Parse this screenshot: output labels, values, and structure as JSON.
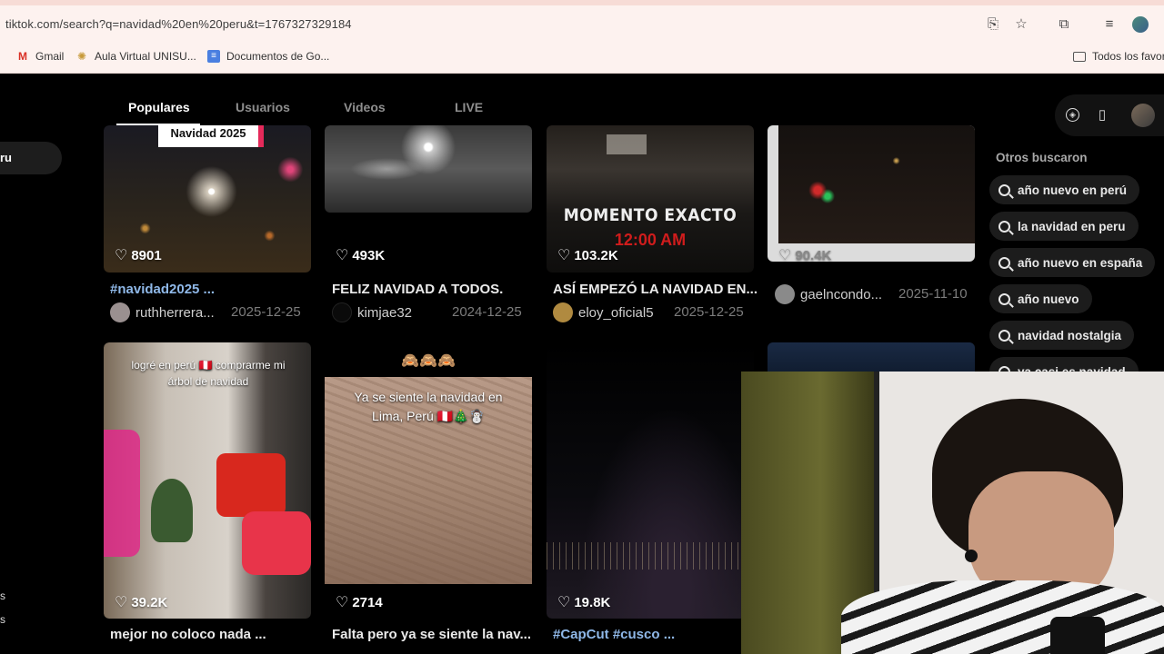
{
  "browser": {
    "url": "tiktok.com/search?q=navidad%20en%20peru&t=1767327329184",
    "bookmarks": [
      {
        "label": "Gmail",
        "icon": "gmail-icon"
      },
      {
        "label": "Aula Virtual UNISU...",
        "icon": "globe-icon"
      },
      {
        "label": "Documentos de Go...",
        "icon": "docs-icon"
      }
    ],
    "bookmarks_folder": "Todos los favor"
  },
  "tabs": [
    {
      "label": "Populares",
      "active": true
    },
    {
      "label": "Usuarios",
      "active": false
    },
    {
      "label": "Videos",
      "active": false
    },
    {
      "label": "LIVE",
      "active": false
    }
  ],
  "left_partial": {
    "pill": "ru",
    "frag1": "s",
    "frag2": "s"
  },
  "videos_row1": [
    {
      "overlay": "Navidad 2025",
      "likes": "8901",
      "desc": "#navidad2025 ...",
      "desc_is_tag": true,
      "user": "ruthherrera...",
      "date": "2025-12-25"
    },
    {
      "overlay": "",
      "likes": "493K",
      "desc": "FELIZ NAVIDAD A TODOS.",
      "desc_is_tag": false,
      "user": "kimjae32",
      "date": "2024-12-25"
    },
    {
      "overlay": "MOMENTO EXACTO",
      "overlay2": "12:00 AM",
      "likes": "103.2K",
      "desc": "ASÍ EMPEZÓ LA NAVIDAD EN...",
      "desc_is_tag": false,
      "user": "eloy_oficial5",
      "date": "2025-12-25"
    },
    {
      "overlay": "",
      "likes": "90.4K",
      "desc": "",
      "desc_is_tag": false,
      "user": "gaelncondo...",
      "date": "2025-11-10"
    }
  ],
  "videos_row2": [
    {
      "overlay": "logré en perú 🇵🇪 comprarme mi árbol de navidad",
      "likes": "39.2K",
      "desc": "mejor no coloco nada ...",
      "desc_is_tag": false
    },
    {
      "overlay_top": "🙈🙈🙈",
      "overlay": "Ya se siente la navidad en Lima, Perú 🇵🇪🎄☃️",
      "likes": "2714",
      "desc": "Falta pero ya se siente la nav...",
      "desc_is_tag": false
    },
    {
      "overlay": "",
      "likes": "19.8K",
      "desc": "#CapCut #cusco ...",
      "desc_is_tag": true
    }
  ],
  "right_panel": {
    "title": "Otros buscaron",
    "suggestions": [
      "año nuevo en perú",
      "la navidad en peru",
      "año nuevo en españa",
      "año nuevo",
      "navidad nostalgia",
      "ya casi es navidad"
    ]
  }
}
